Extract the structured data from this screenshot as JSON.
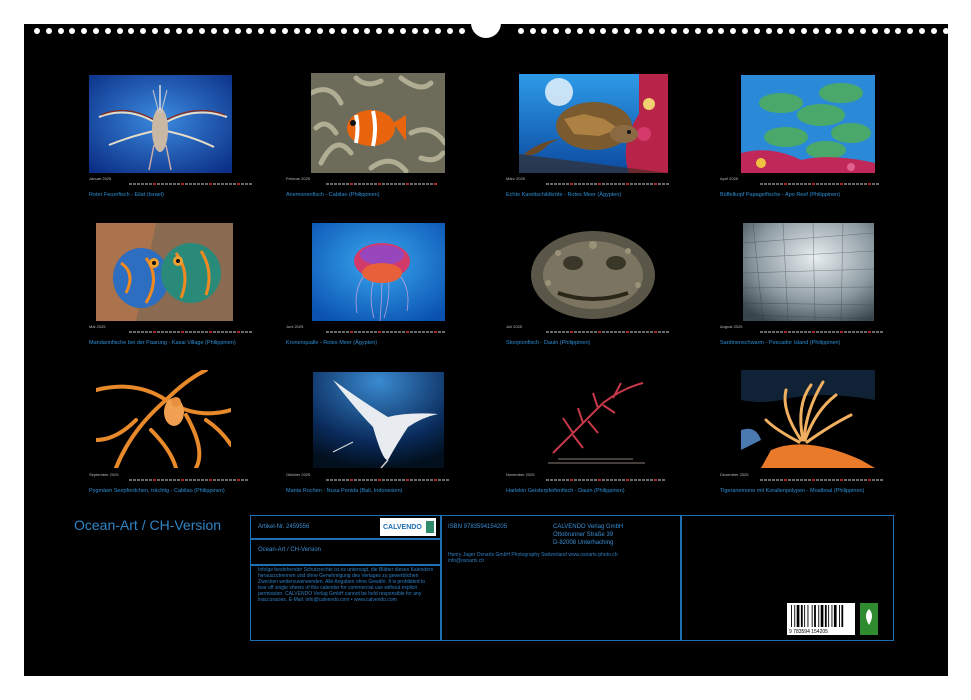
{
  "months": [
    {
      "label": "Januar 2025",
      "caption": "Roter Feuerfisch - Eilat (Israel)"
    },
    {
      "label": "Februar 2025",
      "caption": "Anemonenfisch - Cabilao (Philippinen)"
    },
    {
      "label": "März 2025",
      "caption": "Echte Karettschildkröte - Rotes Meer (Ägypten)"
    },
    {
      "label": "April 2025",
      "caption": "Büffelkopf Papageifische - Apo Reef (Philippinen)"
    },
    {
      "label": "Mai 2025",
      "caption": "Mandarinfische bei der Paarung - Kasai Village (Philippinen)"
    },
    {
      "label": "Juni 2025",
      "caption": "Kronenqualle - Rotes Meer (Ägypten)"
    },
    {
      "label": "Juli 2025",
      "caption": "Skorpionfisch - Dauin (Philippinen)"
    },
    {
      "label": "August 2025",
      "caption": "Sardinenschwarm - Pescador Island (Philippinen)"
    },
    {
      "label": "September 2025",
      "caption": "Pygmäen Seepferdchen, trächtig - Cabilao (Philippinen)"
    },
    {
      "label": "Oktober 2025",
      "caption": "Manta Rochen - Nusa Penida (Bali, Indonesien)"
    },
    {
      "label": "November 2025",
      "caption": "Harlekin Geisterpfeifenfisch - Dauin (Philippinen)"
    },
    {
      "label": "Dezember 2025",
      "caption": "Tigeranemone mit Korallenpolypen - Moalboal (Philippinen)"
    }
  ],
  "cover": {
    "title": "Ocean-Art / CH-Version"
  },
  "info": {
    "article": "Artikel-Nr. 2459556",
    "subtitle": "Ocean-Art / CH-Version",
    "isbn": "ISBN 9783594154205",
    "publisher_lines": [
      "CALVENDO Verlag GmbH",
      "Ottobrunner Straße 39",
      "D-82008 Unterhaching"
    ],
    "photographer": "Henry Jager Osnarts GmbH Photography Switzerland www.osnarts-photo.ch",
    "email": "info@osnarts.ch",
    "legal": "Infolge bestehender Schutzrechte ist es untersagt, die Blätter dieses Kalenders herauszutrennen und ohne Genehmigung des Verlages zu gewerblichen Zwecken weiterzuverwenden. Alle Angaben ohne Gewähr. It is prohibited to tear off single sheets of this calendar for commercial use without explicit permission. CALVENDO Verlag GmbH cannot be held responsible for any inaccuracies. E-Mail: info@calvendo.com • www.calvendo.com",
    "logo_text": "CALVENDO",
    "barcode_text": "9 783594 154205"
  },
  "colors": {
    "accent": "#2b8fd6",
    "frame": "#1e6fb3",
    "sunday": "#a52a2a"
  }
}
